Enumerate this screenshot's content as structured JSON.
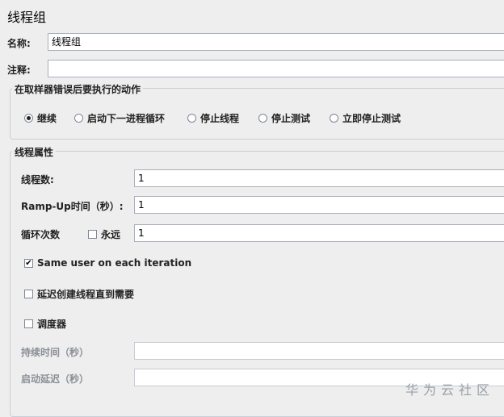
{
  "title": "线程组",
  "name_field": {
    "label": "名称:",
    "value": "线程组"
  },
  "comment_field": {
    "label": "注释:",
    "value": ""
  },
  "on_error": {
    "legend": "在取样器错误后要执行的动作",
    "options": [
      {
        "label": "继续",
        "selected": true
      },
      {
        "label": "启动下一进程循环",
        "selected": false
      },
      {
        "label": "停止线程",
        "selected": false
      },
      {
        "label": "停止测试",
        "selected": false
      },
      {
        "label": "立即停止测试",
        "selected": false
      }
    ]
  },
  "thread_props": {
    "legend": "线程属性",
    "threads": {
      "label": "线程数:",
      "value": "1"
    },
    "ramp_up": {
      "label": "Ramp-Up时间（秒）:",
      "value": "1"
    },
    "loop": {
      "label": "循环次数",
      "forever_label": "永远",
      "forever_checked": false,
      "value": "1"
    },
    "same_user": {
      "label": "Same user on each iteration",
      "checked": true
    },
    "delay_create": {
      "label": "延迟创建线程直到需要",
      "checked": false
    },
    "scheduler": {
      "label": "调度器",
      "checked": false
    },
    "duration": {
      "label": "持续时间（秒）",
      "value": ""
    },
    "startup_delay": {
      "label": "启动延迟（秒）",
      "value": ""
    }
  },
  "watermark": "华为云社区"
}
